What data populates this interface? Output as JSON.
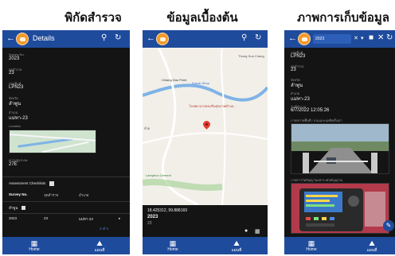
{
  "captions": [
    "พิกัดสำรวจ",
    "ข้อมูลเบื้องต้น",
    "ภาพการเก็บข้อมูล"
  ],
  "phone1": {
    "title": "Details",
    "fields": [
      {
        "label": "Survey No.",
        "value": "2023"
      },
      {
        "label": "จุดสำรวจ",
        "value": "23"
      },
      {
        "label": "รหัสพื้นที่",
        "value": "LPN23"
      },
      {
        "label": "จังหวัด",
        "value": "ลำพูน"
      },
      {
        "label": "อำเภอ",
        "value": "แม่ทา-23"
      },
      {
        "label": "Location",
        "value": ""
      },
      {
        "label": "ความสูง/ระยะ",
        "value": "27E"
      }
    ],
    "section_title": "Assessment Checklists",
    "table_headers": [
      "Survey No.",
      "จุดสำรวจ",
      "อำเภอ"
    ],
    "row_group": "ลำพูน",
    "row": [
      "2023",
      "23",
      "แม่ทา-23"
    ],
    "pagination": "1 of 1",
    "nav": [
      "Home",
      "แผนที่"
    ]
  },
  "phone2": {
    "map_labels": [
      "Thung Hua Chang",
      "โรงพยาบาลส่งเสริมสุขภาพตำบล...",
      "Kanok Shop",
      "Chiang Dao Point",
      "Lamphun Cement",
      "ห้วย"
    ],
    "coords": "18.425312, 99.888169",
    "survey_no": "2023",
    "point_no": "23",
    "nav": [
      "Home",
      "แผนที่"
    ]
  },
  "phone3": {
    "search_value": "2023",
    "fields": [
      {
        "label": "รหัสพื้นที่",
        "value": "LPN23"
      },
      {
        "label": "จุดสำรวจ",
        "value": "23"
      },
      {
        "label": "จังหวัด",
        "value": "ลำพูน"
      },
      {
        "label": "อำเภอ",
        "value": "แม่ทา-23"
      },
      {
        "label": "วันที่สำรวจ",
        "value": "6/7/2022 12:05:26"
      }
    ],
    "photo1_label": "ภาพสภาพพื้นที่ / ถนนและจุดติดตั้งเสา",
    "photo2_label": "ภาพการวัดสัญญาณ/ค่าระดับสัญญาณ",
    "nav": [
      "Home",
      "แผนที่"
    ]
  },
  "colors": {
    "appbar": "#1f4b9c",
    "screen_bg": "#141414",
    "accent": "#f39a2b",
    "pin": "#e23b2e"
  }
}
